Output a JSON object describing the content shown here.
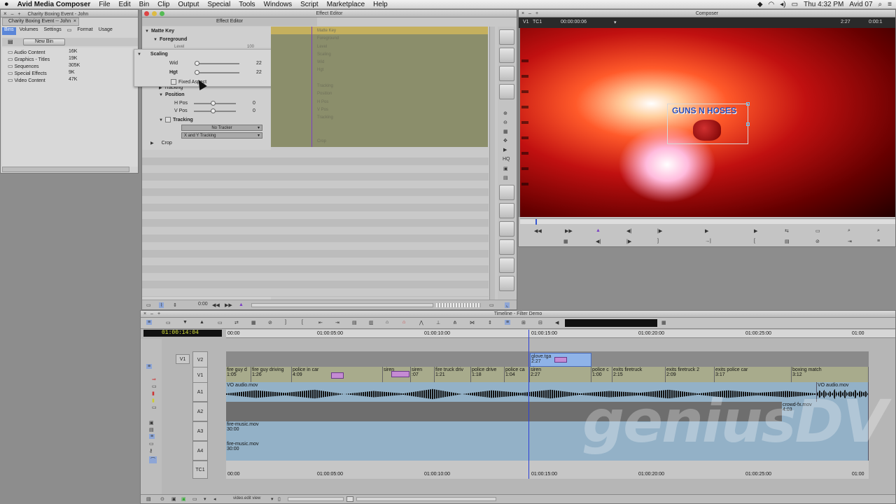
{
  "menubar": {
    "apple": "",
    "app_name": "Avid Media Composer",
    "items": [
      "File",
      "Edit",
      "Bin",
      "Clip",
      "Output",
      "Special",
      "Tools",
      "Windows",
      "Script",
      "Marketplace",
      "Help"
    ],
    "clock": "Thu 4:32 PM",
    "user": "Avid 07"
  },
  "bin": {
    "title": "Charity Boxing Event - John",
    "tab": "Charity Boxing Event -- John",
    "tabs": [
      "Bins",
      "Volumes",
      "Settings",
      "Format",
      "Usage"
    ],
    "new_bin": "New Bin",
    "items": [
      {
        "name": "Audio Content",
        "size": "16K"
      },
      {
        "name": "Graphics - Titles",
        "size": "19K"
      },
      {
        "name": "Sequences",
        "size": "305K"
      },
      {
        "name": "Special Effects",
        "size": "9K"
      },
      {
        "name": "Video Content",
        "size": "47K"
      }
    ]
  },
  "effect_editor": {
    "title": "Effect Editor",
    "matte_key": "Matte Key",
    "foreground": "Foreground",
    "level": "Level",
    "level_value": "100",
    "scaling": "Scaling",
    "wid_label": "Wid",
    "wid_value": "22",
    "hgt_label": "Hgt",
    "hgt_value": "22",
    "fixed_aspect": "Fixed Aspect",
    "tracking_sub": "Tracking",
    "position": "Position",
    "hpos_label": "H Pos",
    "hpos_value": "0",
    "vpos_label": "V Pos",
    "vpos_value": "0",
    "tracking": "Tracking",
    "no_tracker": "No Tracker",
    "xy_tracking": "X and Y Tracking",
    "crop": "Crop",
    "time": "0:00",
    "kf_labels": [
      "Matte Key",
      "Foreground",
      "Level",
      "Scaling",
      "Wid",
      "Hgt",
      "Tracking",
      "Position",
      "H Pos",
      "V Pos",
      "Tracking",
      "Crop"
    ]
  },
  "composer": {
    "title": "Composer",
    "track": "V1",
    "tc_label": "TC1",
    "timecode": "00:00:00:06",
    "duration": "2:27",
    "tc_right": "0:00:1",
    "logo_text": "GUNS N HOSES"
  },
  "timeline": {
    "title": "Timeline - Filter Demo",
    "timecode": "01:00:14:04",
    "ruler": [
      "00:00",
      "01:00:05:00",
      "01:00:10:00",
      "01:00:15:00",
      "01:00:20:00",
      "01:00:25:00",
      "01:00"
    ],
    "tracks": [
      "V2",
      "V1",
      "A1",
      "A2",
      "A3",
      "A4",
      "TC1"
    ],
    "v1_src": "V1",
    "v2_clip": {
      "name": "glove.tga",
      "dur": "2:27"
    },
    "v1_clips": [
      {
        "name": "fire guy d",
        "dur": "1:05"
      },
      {
        "name": "fire guy driving",
        "dur": "1:26"
      },
      {
        "name": "police in car",
        "dur": "4:09"
      },
      {
        "name": "siren",
        "dur": ""
      },
      {
        "name": "siren",
        "dur": ":07"
      },
      {
        "name": "fire truck driv",
        "dur": "1:21"
      },
      {
        "name": "police drive",
        "dur": "1:18"
      },
      {
        "name": "police ca",
        "dur": "1:04"
      },
      {
        "name": "siren",
        "dur": "2:27"
      },
      {
        "name": "police c",
        "dur": "1:00"
      },
      {
        "name": "exits firetruck",
        "dur": "2:15"
      },
      {
        "name": "exits firetruck 2",
        "dur": "2:09"
      },
      {
        "name": "exits police car",
        "dur": "3:17"
      },
      {
        "name": "boxing match",
        "dur": "3:12"
      }
    ],
    "a1_clip": "VO audio.mov",
    "a1_clip2": "VO audio.mov",
    "a2_clip": {
      "name": "crowd-fx.mov",
      "dur": "4:03"
    },
    "a3_clip": {
      "name": "fire-music.mov",
      "dur": "30:00"
    },
    "a4_clip": {
      "name": "fire-music.mov",
      "dur": "30:00"
    },
    "footer_menu": "video.edit view"
  },
  "watermark": "geniusDV",
  "colors": {
    "accent": "#5a86d8",
    "v2_clip": "#8fb3e8",
    "track_olive": "#a8ab8c",
    "audio": "#93b1c7",
    "playhead": "#2b3fd6"
  }
}
